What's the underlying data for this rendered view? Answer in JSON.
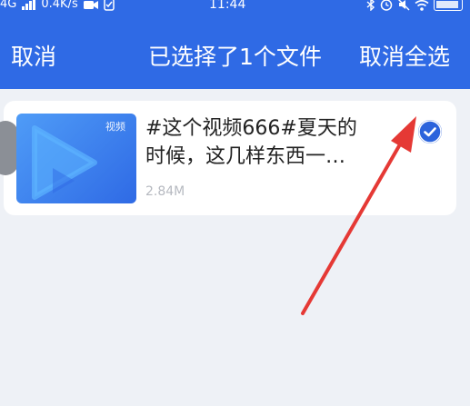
{
  "status_bar": {
    "network": "4G",
    "speed": "0.4K/s",
    "time": "11:44"
  },
  "header": {
    "cancel_label": "取消",
    "title": "已选择了1个文件",
    "deselect_all_label": "取消全选"
  },
  "files": [
    {
      "thumbnail_tag": "视频",
      "title_line1": "#这个视频666#夏天的",
      "title_line2": "时候，这几样东西一…",
      "size": "2.84M",
      "selected": true
    }
  ],
  "colors": {
    "header_blue": "#2f6ae5",
    "page_background": "#eef1f6",
    "checkbox_blue": "#2b63dc",
    "arrow_red": "#e53935"
  },
  "icons": {
    "thumbnail": "play-icon",
    "selected": "check-circle-icon"
  }
}
